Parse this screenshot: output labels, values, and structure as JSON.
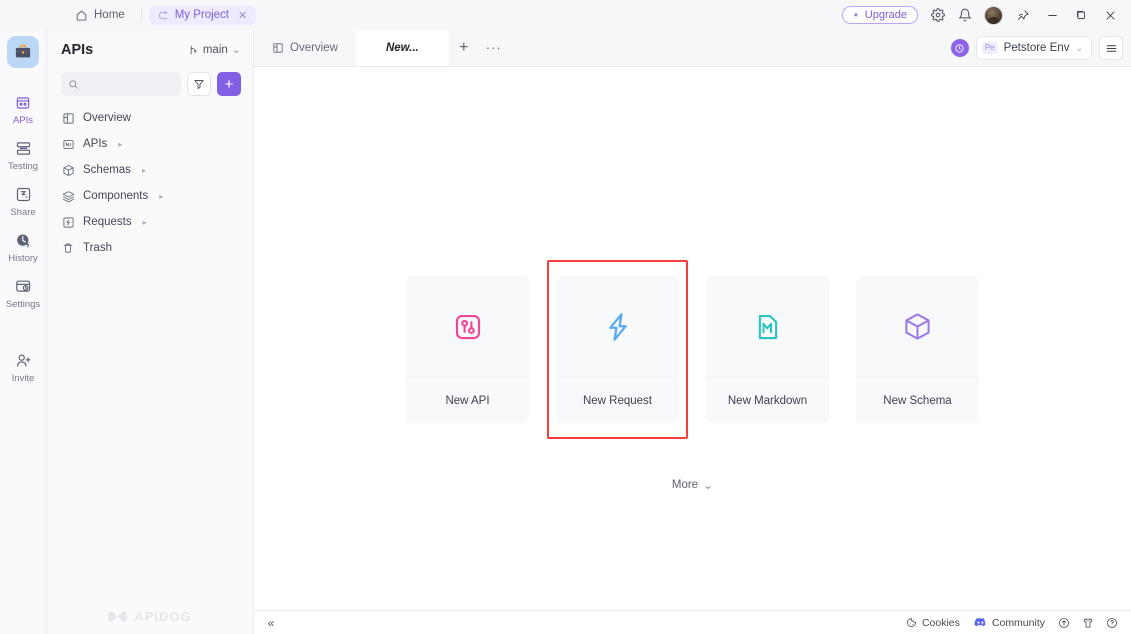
{
  "titlebar": {
    "home_label": "Home",
    "home_icon": "home-icon",
    "project_tab_label": "My Project",
    "project_tab_icon": "project-icon",
    "project_tab_close": "✕",
    "upgrade_label": "Upgrade",
    "upgrade_icon": "rocket-icon",
    "settings_icon": "gear-icon",
    "notification_icon": "bell-icon",
    "avatar_icon": "user-avatar",
    "pin_icon": "pin-icon",
    "minimize_icon": "minimize-icon",
    "maximize_icon": "maximize-icon",
    "close_icon": "close-icon",
    "accent": "#7c5cd6"
  },
  "rail": {
    "logo_icon": "briefcase-icon",
    "items": [
      {
        "label": "APIs",
        "icon": "apis-icon",
        "active": true
      },
      {
        "label": "Testing",
        "icon": "testing-icon",
        "active": false
      },
      {
        "label": "Share",
        "icon": "share-icon",
        "active": false
      },
      {
        "label": "History",
        "icon": "history-icon",
        "active": false
      },
      {
        "label": "Settings",
        "icon": "settings-icon",
        "active": false
      },
      {
        "label": "Invite",
        "icon": "invite-icon",
        "active": false
      }
    ],
    "active_color": "#7c5cd6"
  },
  "sidebar": {
    "title": "APIs",
    "branch_label": "main",
    "branch_icon": "branch-icon",
    "branch_caret": "⌄",
    "search_placeholder": "",
    "search_value": "",
    "search_icon": "search-icon",
    "filter_icon": "filter-icon",
    "add_label": "+",
    "tree": [
      {
        "label": "Overview",
        "icon": "overview-icon",
        "caret": ""
      },
      {
        "label": "APIs",
        "icon": "apis-tree-icon",
        "caret": "▸"
      },
      {
        "label": "Schemas",
        "icon": "schemas-icon",
        "caret": "▸"
      },
      {
        "label": "Components",
        "icon": "components-icon",
        "caret": "▸"
      },
      {
        "label": "Requests",
        "icon": "requests-icon",
        "caret": "▸"
      },
      {
        "label": "Trash",
        "icon": "trash-icon",
        "caret": ""
      }
    ],
    "watermark": "APIDOG",
    "watermark_icon": "apidog-logo"
  },
  "tabbar": {
    "tabs": [
      {
        "label": "Overview",
        "icon": "overview-tab-icon",
        "active": false
      },
      {
        "label": "New...",
        "icon": "",
        "active": true
      }
    ],
    "new_tab_label": "+",
    "more_tabs_label": "···",
    "env_circle_icon": "env-status-icon",
    "env_badge": "Pe",
    "env_label": "Petstore Env",
    "env_caret": "⌄",
    "menu_icon": "hamburger-icon"
  },
  "canvas": {
    "cards": [
      {
        "label": "New API",
        "icon": "new-api-icon",
        "color": "#ec4899",
        "selected": false
      },
      {
        "label": "New Request",
        "icon": "new-request-icon",
        "color": "#5aa9f0",
        "selected": true
      },
      {
        "label": "New Markdown",
        "icon": "new-markdown-icon",
        "color": "#2bc4c4",
        "selected": false
      },
      {
        "label": "New Schema",
        "icon": "new-schema-icon",
        "color": "#9a7bea",
        "selected": false
      }
    ],
    "more_label": "More",
    "more_caret": "⌄",
    "selection_color": "#fa3c3c"
  },
  "statusbar": {
    "collapse_icon": "collapse-sidebar-icon",
    "collapse_label": "«",
    "cookies_label": "Cookies",
    "cookies_icon": "cookie-icon",
    "community_label": "Community",
    "community_icon": "discord-icon",
    "upload_icon": "upload-circle-icon",
    "shirt_icon": "shirt-icon",
    "help_icon": "help-circle-icon"
  }
}
